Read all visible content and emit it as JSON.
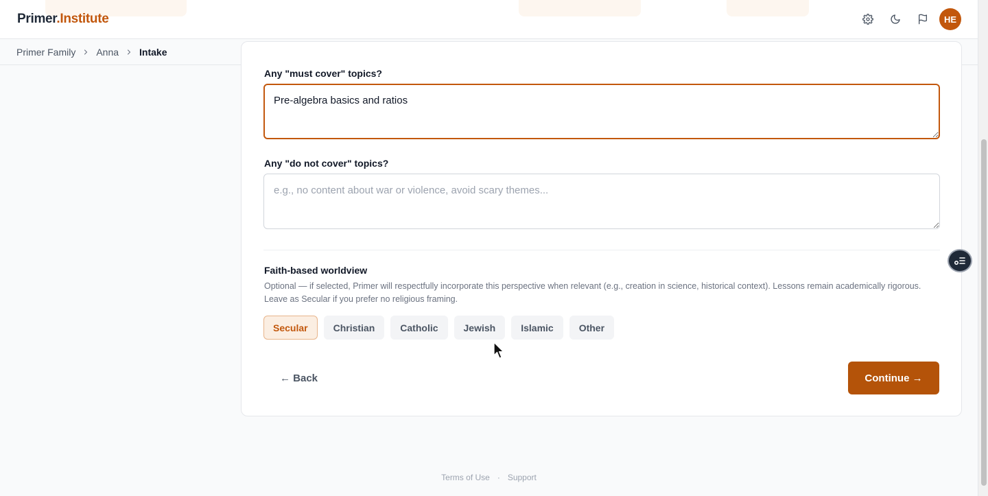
{
  "app": {
    "logo_primary": "Primer",
    "logo_secondary": ".Institute"
  },
  "header": {
    "icons": [
      "gear-icon",
      "moon-icon",
      "flag-icon"
    ],
    "avatar_initials": "HE"
  },
  "breadcrumb": [
    "Primer Family",
    "Anna",
    "Intake"
  ],
  "form": {
    "must_cover": {
      "label": "Any \"must cover\" topics?",
      "value": "Pre-algebra basics and ratios",
      "placeholder": ""
    },
    "do_not_cover": {
      "label": "Any \"do not cover\" topics?",
      "value": "",
      "placeholder": "e.g., no content about war or violence, avoid scary themes..."
    },
    "faith": {
      "label": "Faith-based worldview",
      "hint": "Optional — if selected, Primer will respectfully incorporate this perspective when relevant (e.g., creation in science, historical context). Lessons remain academically rigorous. Leave as Secular if you prefer no religious framing.",
      "options": [
        "Secular",
        "Christian",
        "Catholic",
        "Jewish",
        "Islamic",
        "Other"
      ],
      "selected": "Secular"
    },
    "back_label": "← Back",
    "continue_label": "Continue →"
  },
  "footer": {
    "terms": "Terms of Use",
    "separator": "·",
    "support": "Support"
  },
  "colors": {
    "brand": "#c2570c",
    "button": "#b45309",
    "chip_selected_bg": "#fbeee2"
  }
}
